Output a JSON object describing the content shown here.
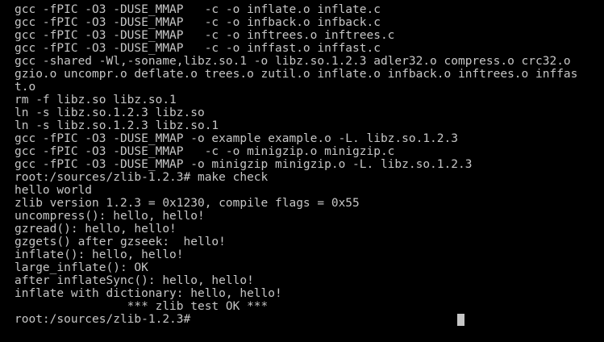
{
  "terminal": {
    "lines": [
      "gcc -fPIC -O3 -DUSE_MMAP   -c -o inflate.o inflate.c",
      "gcc -fPIC -O3 -DUSE_MMAP   -c -o infback.o infback.c",
      "gcc -fPIC -O3 -DUSE_MMAP   -c -o inftrees.o inftrees.c",
      "gcc -fPIC -O3 -DUSE_MMAP   -c -o inffast.o inffast.c",
      "gcc -shared -Wl,-soname,libz.so.1 -o libz.so.1.2.3 adler32.o compress.o crc32.o",
      "gzio.o uncompr.o deflate.o trees.o zutil.o inflate.o infback.o inftrees.o inffas",
      "t.o",
      "rm -f libz.so libz.so.1",
      "ln -s libz.so.1.2.3 libz.so",
      "ln -s libz.so.1.2.3 libz.so.1",
      "gcc -fPIC -O3 -DUSE_MMAP -o example example.o -L. libz.so.1.2.3",
      "gcc -fPIC -O3 -DUSE_MMAP   -c -o minigzip.o minigzip.c",
      "gcc -fPIC -O3 -DUSE_MMAP -o minigzip minigzip.o -L. libz.so.1.2.3",
      "root:/sources/zlib-1.2.3# make check",
      "hello world",
      "zlib version 1.2.3 = 0x1230, compile flags = 0x55",
      "uncompress(): hello, hello!",
      "gzread(): hello, hello!",
      "gzgets() after gzseek:  hello!",
      "inflate(): hello, hello!",
      "large_inflate(): OK",
      "after inflateSync(): hello, hello!",
      "inflate with dictionary: hello, hello!",
      "                *** zlib test OK ***",
      "root:/sources/zlib-1.2.3#"
    ]
  }
}
